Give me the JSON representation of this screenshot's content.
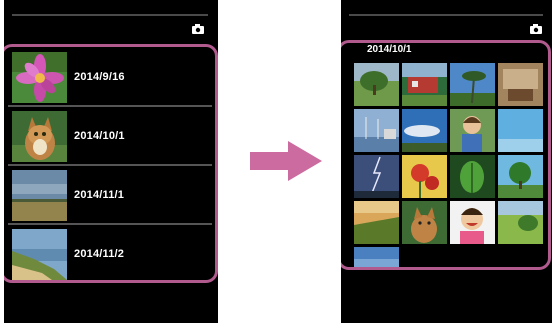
{
  "left_screen": {
    "items": [
      {
        "date": "2014/9/16",
        "thumbnail": "pink-flower"
      },
      {
        "date": "2014/10/1",
        "thumbnail": "cat"
      },
      {
        "date": "2014/11/1",
        "thumbnail": "field-landscape"
      },
      {
        "date": "2014/11/2",
        "thumbnail": "coast-landscape"
      }
    ],
    "camera_icon": "camera-icon"
  },
  "right_screen": {
    "group_date": "2014/10/1",
    "camera_icon": "camera-icon",
    "grid_thumbnails": [
      "tree-field",
      "building-red",
      "palm-sky",
      "room-interior",
      "harbor-sailboats",
      "sky-clouds",
      "child-portrait",
      "blue-sky",
      "lightning-storm",
      "red-flowers",
      "green-plant",
      "green-tree",
      "hill-sunset",
      "cat",
      "smiling-child",
      "green-landscape",
      "blue-sky-partial"
    ]
  },
  "arrow_icon": "arrow-right-icon",
  "colors": {
    "highlight": "#b05a8d",
    "arrow": "#cc6b9f",
    "screen_bg": "#000000",
    "text": "#ffffff"
  }
}
